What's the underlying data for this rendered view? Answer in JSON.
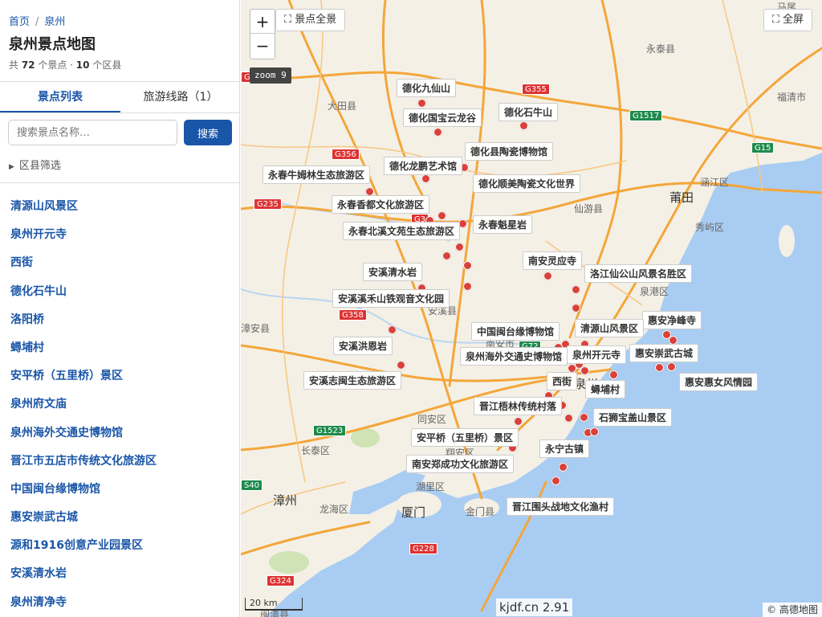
{
  "breadcrumb": {
    "home": "首页",
    "separator": "/",
    "current": "泉州"
  },
  "header": {
    "title": "泉州景点地图",
    "stats_prefix": "共 ",
    "spot_count": "72",
    "stats_mid": " 个景点 · ",
    "district_count": "10",
    "stats_suffix": " 个区县"
  },
  "tabs": [
    {
      "label": "景点列表",
      "active": true
    },
    {
      "label": "旅游线路（1）",
      "active": false
    }
  ],
  "search": {
    "placeholder": "搜索景点名称…",
    "value": "",
    "button": "搜索"
  },
  "district_filter": {
    "label": "区县筛选",
    "icon": "caret-right-icon"
  },
  "spot_list": [
    "清源山风景区",
    "泉州开元寺",
    "西街",
    "德化石牛山",
    "洛阳桥",
    "蟳埔村",
    "安平桥（五里桥）景区",
    "泉州府文庙",
    "泉州海外交通史博物馆",
    "晋江市五店市传统文化旅游区",
    "中国闽台缘博物馆",
    "惠安崇武古城",
    "源和1916创意产业园景区",
    "安溪清水岩",
    "泉州清净寺"
  ],
  "map": {
    "zoom_in": "+",
    "zoom_out": "−",
    "zoom_level": "zoom 9",
    "overview_button": "⛶ 景点全景",
    "fullscreen_button": "⛶ 全屏",
    "scale": "20 km",
    "version": "kjdf.cn 2.91",
    "attribution": "© 高德地图",
    "colors": {
      "marker": "#d9413a",
      "sea": "#a9cdf2",
      "land": "#f4f0e6",
      "road": "#f4a63a",
      "accent": "#1a56a8"
    },
    "poi_labels": [
      "德化九仙山",
      "德化石牛山",
      "德化国宝云龙谷",
      "德化县陶瓷博物馆",
      "德化龙鹏艺术馆",
      "永春牛姆林生态旅游区",
      "德化顺美陶瓷文化世界",
      "永春香都文化旅游区",
      "永春魁星岩",
      "永春北溪文苑生态旅游区",
      "南安灵应寺",
      "安溪清水岩",
      "洛江仙公山风景名胜区",
      "安溪溪禾山铁观音文化园",
      "惠安净峰寺",
      "中国闽台缘博物馆",
      "清源山风景区",
      "安溪洪恩岩",
      "泉州海外交通史博物馆",
      "泉州开元寺",
      "惠安崇武古城",
      "安溪志闽生态旅游区",
      "西街",
      "惠安惠女风情园",
      "蟳埔村",
      "晋江梧林传统村落",
      "石狮宝盖山景区",
      "安平桥（五里桥）景区",
      "永宁古镇",
      "南安郑成功文化旅游区",
      "晋江围头战地文化渔村"
    ],
    "places": [
      "马尾",
      "永泰县",
      "大田县",
      "福清市",
      "涵江区",
      "莆田",
      "仙游县",
      "秀屿区",
      "泉港区",
      "安溪县",
      "漳安县",
      "南安市",
      "泉州",
      "同安区",
      "长泰区",
      "翔安区",
      "湖里区",
      "漳州",
      "龙海区",
      "厦门",
      "金门县",
      "闽清县"
    ],
    "road_shields": [
      "G355",
      "G1517",
      "G356",
      "G235",
      "G3",
      "G15",
      "G358",
      "G72",
      "G228",
      "G1523",
      "S40",
      "G324",
      "G3"
    ]
  }
}
